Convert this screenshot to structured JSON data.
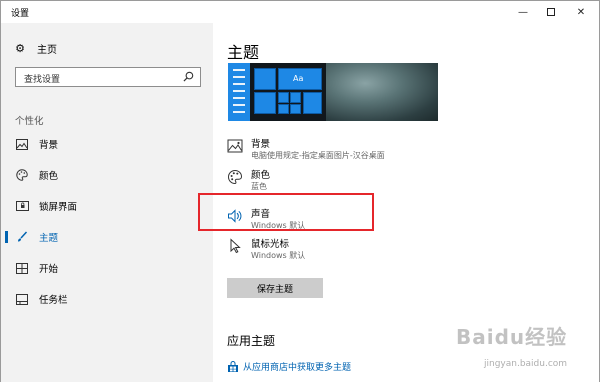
{
  "window": {
    "title": "设置",
    "controls": {
      "minimize": "—",
      "close": "✕"
    }
  },
  "nav": {
    "home_label": "主页",
    "search_placeholder": "查找设置",
    "group_label": "个性化",
    "items": [
      {
        "label": "背景",
        "icon": "picture-icon",
        "active": false
      },
      {
        "label": "颜色",
        "icon": "palette-icon",
        "active": false
      },
      {
        "label": "锁屏界面",
        "icon": "lock-screen-icon",
        "active": false
      },
      {
        "label": "主题",
        "icon": "brush-icon",
        "active": true
      },
      {
        "label": "开始",
        "icon": "start-icon",
        "active": false
      },
      {
        "label": "任务栏",
        "icon": "taskbar-icon",
        "active": false
      }
    ]
  },
  "main": {
    "title": "主题",
    "preview": {
      "tile_text": "Aa"
    },
    "settings": [
      {
        "name": "背景",
        "value": "电脑使用规定-指定桌面图片-汉谷桌面",
        "icon": "picture-icon"
      },
      {
        "name": "颜色",
        "value": "蓝色",
        "icon": "palette-icon"
      },
      {
        "name": "声音",
        "value": "Windows 默认",
        "icon": "speaker-icon"
      },
      {
        "name": "鼠标光标",
        "value": "Windows 默认",
        "icon": "cursor-icon"
      }
    ],
    "save_button": "保存主题",
    "app_theme_title": "应用主题",
    "store_link": "从应用商店中获取更多主题"
  },
  "watermark": {
    "logo": "Baidu经验",
    "url": "jingyan.baidu.com"
  },
  "colors": {
    "accent": "#0063b1",
    "highlight_border": "#e5262b",
    "nav_background": "#f2f2f2"
  }
}
